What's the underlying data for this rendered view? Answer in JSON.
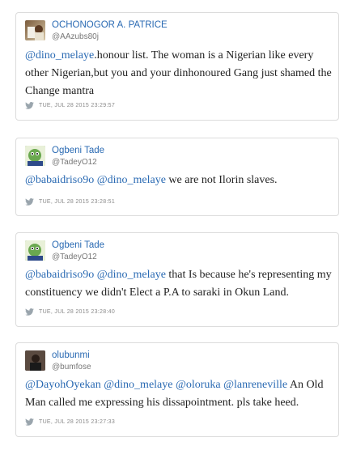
{
  "tweets": [
    {
      "name": "OCHONOGOR A. PATRICE",
      "handle": "@AAzubs80j",
      "text_parts": [
        "@dino_melaye",
        ".honour list. The woman is a Nigerian like every other Nigerian,but you and your dinhonoured Gang just shamed the Change mantra"
      ],
      "timestamp": "TUE, JUL 28 2015 23:29:57",
      "avatar_colors": [
        "#7a5a3a",
        "#d8c8a8"
      ]
    },
    {
      "name": "Ogbeni Tade",
      "handle": "@TadeyO12",
      "text_parts": [
        "@babaidriso9o",
        " ",
        "@dino_melaye",
        " we are not Ilorin slaves."
      ],
      "timestamp": "TUE, JUL 28 2015 23:28:51",
      "avatar_colors": [
        "#4a7a3a",
        "#8bc34a"
      ]
    },
    {
      "name": "Ogbeni Tade",
      "handle": "@TadeyO12",
      "text_parts": [
        "@babaidriso9o",
        " ",
        "@dino_melaye",
        " that Is because he's representing my constituency we didn't Elect a P.A to saraki in Okun Land."
      ],
      "timestamp": "TUE, JUL 28 2015 23:28:40",
      "avatar_colors": [
        "#4a7a3a",
        "#8bc34a"
      ]
    },
    {
      "name": "olubunmi",
      "handle": "@bumfose",
      "text_parts": [
        "@DayohOyekan",
        " ",
        "@dino_melaye",
        " ",
        "@oloruka",
        " ",
        "@lanreneville",
        " An Old Man called me expressing his dissapointment. pls take heed."
      ],
      "timestamp": "TUE, JUL 28 2015 23:27:33",
      "avatar_colors": [
        "#3a3a3a",
        "#9a8a7a"
      ]
    }
  ],
  "colors": {
    "link": "#2a6ab3",
    "meta": "#8a8a8a",
    "border": "#dcdcdc"
  },
  "icons": {
    "bird": "twitter-bird-icon"
  }
}
